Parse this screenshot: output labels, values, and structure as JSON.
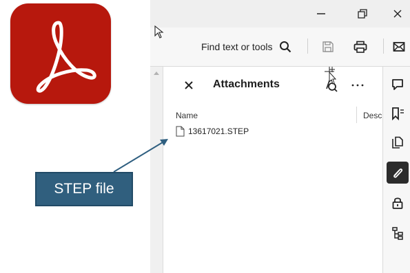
{
  "window": {
    "minimize_icon": "minimize-icon",
    "restore_icon": "restore-icon",
    "close_icon": "close-icon"
  },
  "toolbar": {
    "find_label": "Find text or tools",
    "search_icon": "search-icon",
    "save_icon": "save-icon",
    "print_icon": "print-icon",
    "mail_icon": "mail-icon"
  },
  "attachments_panel": {
    "title": "Attachments",
    "close_icon": "close-icon",
    "search_icon": "search-attachments-icon",
    "more_icon": "more-options-icon",
    "columns": [
      "Name",
      "Desc"
    ],
    "files": [
      {
        "name": "13617021.STEP",
        "icon": "file-icon"
      }
    ]
  },
  "right_rail": {
    "items": [
      {
        "icon": "comment-icon",
        "active": false
      },
      {
        "icon": "bookmark-icon",
        "active": false
      },
      {
        "icon": "pages-icon",
        "active": false
      },
      {
        "icon": "attachment-icon",
        "active": true
      },
      {
        "icon": "lock-icon",
        "active": false
      },
      {
        "icon": "structure-icon",
        "active": false
      }
    ]
  },
  "annotation": {
    "label": "STEP file",
    "fill_color": "#305f7e",
    "arrow_color": "#2f5f80"
  },
  "logo": {
    "name": "adobe-acrobat-logo",
    "color": "#b7180d"
  }
}
